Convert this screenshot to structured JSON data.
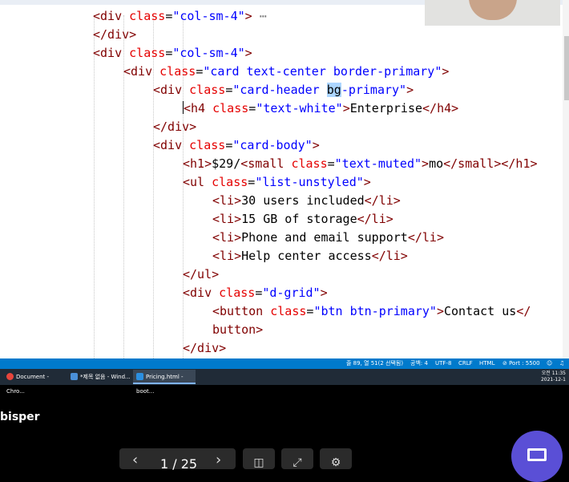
{
  "code_lines": [
    {
      "indent": 116,
      "parts": [
        [
          "tag",
          "<div "
        ],
        [
          "attr",
          "class"
        ],
        [
          "txt",
          "="
        ],
        [
          "val",
          "\"col-sm-4\""
        ],
        [
          "tag",
          ">"
        ],
        [
          "fold",
          " ⋯"
        ]
      ]
    },
    {
      "indent": 116,
      "parts": [
        [
          "tag",
          "</div>"
        ]
      ]
    },
    {
      "indent": 116,
      "parts": [
        [
          "tag",
          "<div "
        ],
        [
          "attr",
          "class"
        ],
        [
          "txt",
          "="
        ],
        [
          "val",
          "\"col-sm-4\""
        ],
        [
          "tag",
          ">"
        ]
      ]
    },
    {
      "indent": 154,
      "parts": [
        [
          "tag",
          "<div "
        ],
        [
          "attr",
          "class"
        ],
        [
          "txt",
          "="
        ],
        [
          "val",
          "\"card text-center border-primary\""
        ],
        [
          "tag",
          ">"
        ]
      ]
    },
    {
      "indent": 191,
      "parts": [
        [
          "tag",
          "<div "
        ],
        [
          "attr",
          "class"
        ],
        [
          "txt",
          "="
        ],
        [
          "val",
          "\"card-header "
        ],
        [
          "sel",
          "bg"
        ],
        [
          "val",
          "-primary\""
        ],
        [
          "tag",
          ">"
        ]
      ]
    },
    {
      "indent": 228,
      "parts": [
        [
          "tag",
          "<h4 "
        ],
        [
          "attr",
          "class"
        ],
        [
          "txt",
          "="
        ],
        [
          "val",
          "\"text-white\""
        ],
        [
          "tag",
          ">"
        ],
        [
          "txt",
          "Enterprise"
        ],
        [
          "tag",
          "</h4>"
        ]
      ]
    },
    {
      "indent": 191,
      "parts": [
        [
          "tag",
          "</div>"
        ]
      ]
    },
    {
      "indent": 191,
      "parts": [
        [
          "tag",
          "<div "
        ],
        [
          "attr",
          "class"
        ],
        [
          "txt",
          "="
        ],
        [
          "val",
          "\"card-body\""
        ],
        [
          "tag",
          ">"
        ]
      ]
    },
    {
      "indent": 228,
      "parts": [
        [
          "tag",
          "<h1>"
        ],
        [
          "txt",
          "$29/"
        ],
        [
          "tag",
          "<small "
        ],
        [
          "attr",
          "class"
        ],
        [
          "txt",
          "="
        ],
        [
          "val",
          "\"text-muted\""
        ],
        [
          "tag",
          ">"
        ],
        [
          "txt",
          "mo"
        ],
        [
          "tag",
          "</small></h1>"
        ]
      ]
    },
    {
      "indent": 228,
      "parts": [
        [
          "tag",
          "<ul "
        ],
        [
          "attr",
          "class"
        ],
        [
          "txt",
          "="
        ],
        [
          "val",
          "\"list-unstyled\""
        ],
        [
          "tag",
          ">"
        ]
      ]
    },
    {
      "indent": 265,
      "parts": [
        [
          "tag",
          "<li>"
        ],
        [
          "txt",
          "30 users included"
        ],
        [
          "tag",
          "</li>"
        ]
      ]
    },
    {
      "indent": 265,
      "parts": [
        [
          "tag",
          "<li>"
        ],
        [
          "txt",
          "15 GB of storage"
        ],
        [
          "tag",
          "</li>"
        ]
      ]
    },
    {
      "indent": 265,
      "parts": [
        [
          "tag",
          "<li>"
        ],
        [
          "txt",
          "Phone and email support"
        ],
        [
          "tag",
          "</li>"
        ]
      ]
    },
    {
      "indent": 265,
      "parts": [
        [
          "tag",
          "<li>"
        ],
        [
          "txt",
          "Help center access"
        ],
        [
          "tag",
          "</li>"
        ]
      ]
    },
    {
      "indent": 228,
      "parts": [
        [
          "tag",
          "</ul>"
        ]
      ]
    },
    {
      "indent": 228,
      "parts": [
        [
          "tag",
          "<div "
        ],
        [
          "attr",
          "class"
        ],
        [
          "txt",
          "="
        ],
        [
          "val",
          "\"d-grid\""
        ],
        [
          "tag",
          ">"
        ]
      ]
    },
    {
      "indent": 265,
      "parts": [
        [
          "tag",
          "<button "
        ],
        [
          "attr",
          "class"
        ],
        [
          "txt",
          "="
        ],
        [
          "val",
          "\"btn btn-primary\""
        ],
        [
          "tag",
          ">"
        ],
        [
          "txt",
          "Contact us"
        ],
        [
          "tag",
          "</"
        ]
      ]
    },
    {
      "indent": 265,
      "parts": [
        [
          "tag",
          "button>"
        ]
      ]
    },
    {
      "indent": 228,
      "parts": [
        [
          "tag",
          "</div>"
        ]
      ]
    }
  ],
  "statusbar": {
    "position": "줄 89, 열 51(2 선택됨)",
    "spaces": "공백: 4",
    "encoding": "UTF-8",
    "eol": "CRLF",
    "language": "HTML",
    "port": "⊘ Port : 5500"
  },
  "taskbar": {
    "items": [
      {
        "label": "Document - Chro...",
        "color": "#e8453c"
      },
      {
        "label": "*제목 없음 - Wind...",
        "color": "#4a90d9"
      },
      {
        "label": "Pricing.html - boot...",
        "color": "#2b8fe0"
      }
    ],
    "clock_time": "오전 11:35",
    "clock_date": "2021-12-1"
  },
  "speaker_name": "bisper",
  "pager": {
    "label": "1 / 25",
    "prev": "‹",
    "next": "›"
  },
  "colors": {
    "accent": "#5a4fd6",
    "statusbar": "#007acc"
  }
}
